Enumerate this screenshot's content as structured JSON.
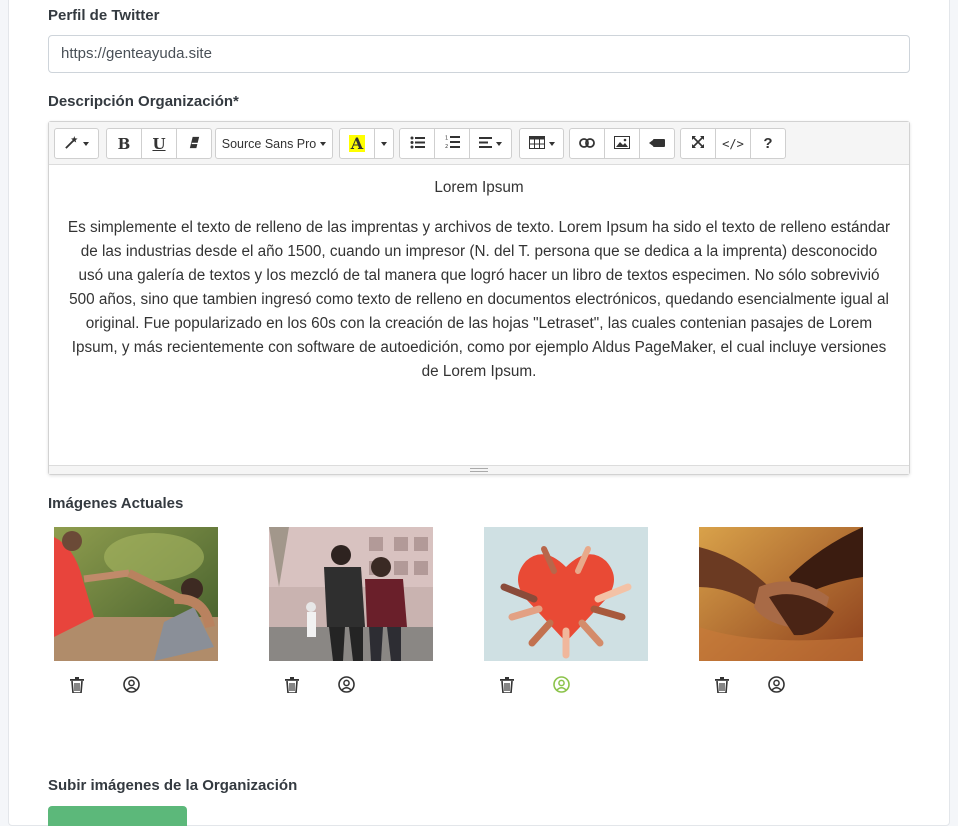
{
  "twitter": {
    "label": "Perfil de Twitter",
    "value": "https://genteayuda.site"
  },
  "description": {
    "label": "Descripción Organización*",
    "toolbar": {
      "font_name": "Source Sans Pro",
      "bold": "B",
      "underline": "U",
      "highlight": "A",
      "code": "</>",
      "help": "?"
    },
    "title": "Lorem Ipsum",
    "body": "Es simplemente el texto de relleno de las imprentas y archivos de texto. Lorem Ipsum ha sido el texto de relleno estándar de las industrias desde el año 1500, cuando un impresor (N. del T. persona que se dedica a la imprenta) desconocido usó una galería de textos y los mezcló de tal manera que logró hacer un libro de textos especimen. No sólo sobrevivió 500 años, sino que tambien ingresó como texto de relleno en documentos electrónicos, quedando esencialmente igual al original. Fue popularizado en los 60s con la creación de las hojas \"Letraset\", las cuales contenian pasajes de Lorem Ipsum, y más recientemente con software de autoedición, como por ejemplo Aldus PageMaker, el cual incluye versiones de Lorem Ipsum."
  },
  "images": {
    "label": "Imágenes Actuales",
    "items": [
      {
        "icon": "helping-hand-photo",
        "profile_active": false
      },
      {
        "icon": "supporting-friend-photo",
        "profile_active": false
      },
      {
        "icon": "heart-hands-illustration",
        "profile_active": true
      },
      {
        "icon": "holding-hands-photo",
        "profile_active": false
      }
    ]
  },
  "upload": {
    "label": "Subir imágenes de la Organización"
  },
  "colors": {
    "active_profile": "#8bc34a",
    "icon": "#333333",
    "upload_button": "#5cb87a"
  }
}
